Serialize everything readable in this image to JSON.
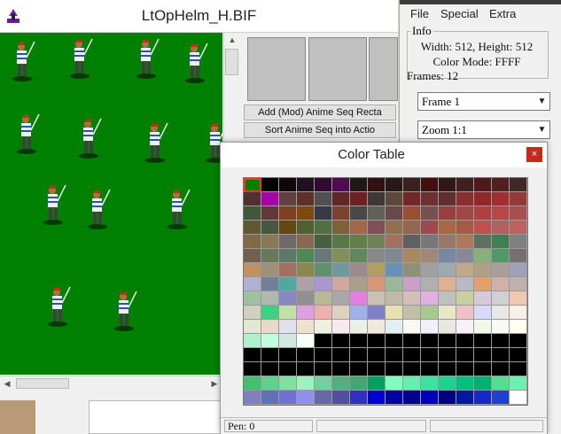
{
  "main_window": {
    "title": "LtOpHelm_H.BIF",
    "buttons": {
      "add_anime": "Add (Mod) Anime Seq Recta",
      "sort_anime": "Sort  Anime Seq into Actio"
    }
  },
  "menu": {
    "file": "File",
    "special": "Special",
    "extra": "Extra"
  },
  "info": {
    "legend": "Info",
    "dimensions": "Width: 512, Height: 512",
    "color_mode": "Color Mode: FFFF",
    "frames": "Frames: 12"
  },
  "frame_select": {
    "value": "Frame 1"
  },
  "zoom_select": {
    "value": "Zoom 1:1"
  },
  "color_table": {
    "title": "Color Table",
    "close_glyph": "×",
    "pen": "Pen: 0",
    "selected_index": 0,
    "colors": [
      "#008000",
      "#000000",
      "#100808",
      "#201020",
      "#300a30",
      "#500a50",
      "#201818",
      "#301010",
      "#281818",
      "#382020",
      "#401010",
      "#301818",
      "#402020",
      "#501818",
      "#502020",
      "#402828",
      "#503030",
      "#a800a8",
      "#604040",
      "#603028",
      "#505050",
      "#602828",
      "#702020",
      "#403838",
      "#604838",
      "#702828",
      "#703030",
      "#603030",
      "#883030",
      "#902828",
      "#a03030",
      "#983838",
      "#405838",
      "#603838",
      "#804020",
      "#804810",
      "#383848",
      "#804030",
      "#484848",
      "#606058",
      "#684848",
      "#985030",
      "#785050",
      "#984040",
      "#a04848",
      "#b04040",
      "#b84848",
      "#a85050",
      "#605830",
      "#485840",
      "#604810",
      "#506030",
      "#507040",
      "#806038",
      "#a06848",
      "#805058",
      "#907050",
      "#906850",
      "#a04850",
      "#a86848",
      "#a85848",
      "#c05050",
      "#b06060",
      "#c06060",
      "#806848",
      "#887858",
      "#706868",
      "#886850",
      "#486040",
      "#587848",
      "#608048",
      "#708058",
      "#a07060",
      "#606060",
      "#787878",
      "#987868",
      "#b07858",
      "#607060",
      "#408050",
      "#808080",
      "#706050",
      "#687858",
      "#607868",
      "#508850",
      "#687878",
      "#809058",
      "#608858",
      "#888888",
      "#808890",
      "#a88860",
      "#a08878",
      "#7888a0",
      "#888898",
      "#88b078",
      "#509868",
      "#787070",
      "#c09060",
      "#a09078",
      "#a07060",
      "#888850",
      "#609070",
      "#7098a0",
      "#a08890",
      "#b0a060",
      "#6890b8",
      "#909078",
      "#a0a0a0",
      "#a0a8b0",
      "#c0a888",
      "#b0a088",
      "#a8a098",
      "#a0a0b8",
      "#b0b0d0",
      "#708098",
      "#50a8a0",
      "#b0a0a8",
      "#a898d0",
      "#d0a8a0",
      "#a8a088",
      "#d89878",
      "#98b898",
      "#c8a0c8",
      "#b0b0b0",
      "#e0b090",
      "#b8b8c8",
      "#e0a070",
      "#d0b0a8",
      "#c0b0b0",
      "#a0c0a0",
      "#b0b8b0",
      "#8888c0",
      "#909090",
      "#b8b898",
      "#a8a8a8",
      "#e080e0",
      "#c8c0b0",
      "#c0b8a8",
      "#d0c0b8",
      "#e0b0e0",
      "#c0c0c0",
      "#c8d0a0",
      "#d8c8d8",
      "#d0d0d0",
      "#f0c8b0",
      "#d0d0c0",
      "#40d080",
      "#c0e0a8",
      "#e0a0e0",
      "#f0b0b0",
      "#e0d0c0",
      "#a0b0e8",
      "#8080c8",
      "#e8e0b0",
      "#c0c0a8",
      "#a8c890",
      "#e8e8c8",
      "#f0c0c8",
      "#d8d8f8",
      "#e8e8e8",
      "#f8f0e8",
      "#e0e8d0",
      "#e8d8c8",
      "#e0e0f0",
      "#f0e0d0",
      "#f0f0e0",
      "#f8e8f0",
      "#e8f0e8",
      "#f0e8d8",
      "#e0f0f0",
      "#f8f8f0",
      "#f0f0f8",
      "#e8e8e0",
      "#f8f0f8",
      "#f0f8e8",
      "#f8f8f8",
      "#fffff0",
      "#b0f0d0",
      "#c0ffe0",
      "#d0e8e0",
      "#f8fff8",
      "#000000",
      "#000000",
      "#000000",
      "#000000",
      "#000000",
      "#000000",
      "#000000",
      "#000000",
      "#000000",
      "#000000",
      "#000000",
      "#000000",
      "#000000",
      "#000000",
      "#000000",
      "#000000",
      "#000000",
      "#000000",
      "#000000",
      "#000000",
      "#000000",
      "#000000",
      "#000000",
      "#000000",
      "#000000",
      "#000000",
      "#000000",
      "#000000",
      "#000000",
      "#000000",
      "#000000",
      "#000000",
      "#000000",
      "#000000",
      "#000000",
      "#000000",
      "#000000",
      "#000000",
      "#000000",
      "#000000",
      "#000000",
      "#000000",
      "#000000",
      "#000000",
      "#40c070",
      "#60d090",
      "#80e0a0",
      "#a0f0c0",
      "#70d0a0",
      "#50b080",
      "#40a870",
      "#00a060",
      "#80ffc0",
      "#60f0b0",
      "#40e0a0",
      "#20d090",
      "#00c080",
      "#00b070",
      "#50e090",
      "#70f0b0",
      "#8080c0",
      "#6070b8",
      "#7070d0",
      "#9090f0",
      "#6868a8",
      "#5050a0",
      "#3030c0",
      "#0000d0",
      "#0000a0",
      "#000090",
      "#0000b8",
      "#000080",
      "#0018a0",
      "#1828c0",
      "#2040d0",
      "#ffffff"
    ]
  }
}
